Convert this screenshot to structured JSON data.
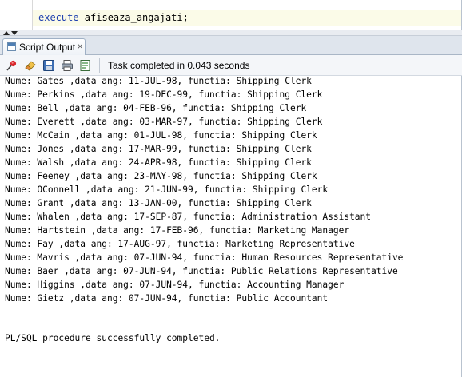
{
  "editor": {
    "code_keyword": "execute",
    "code_rest": " afiseaza_angajati;"
  },
  "output_panel": {
    "tab_label": "Script Output",
    "tab_close": "×",
    "status_text": "Task completed in 0.043 seconds",
    "toolbar_icons": [
      "pin-icon",
      "eraser-icon",
      "save-icon",
      "print-icon",
      "log-icon"
    ]
  },
  "output": {
    "lines": [
      "Nume: Gates ,data ang: 11-JUL-98, functia: Shipping Clerk",
      "Nume: Perkins ,data ang: 19-DEC-99, functia: Shipping Clerk",
      "Nume: Bell ,data ang: 04-FEB-96, functia: Shipping Clerk",
      "Nume: Everett ,data ang: 03-MAR-97, functia: Shipping Clerk",
      "Nume: McCain ,data ang: 01-JUL-98, functia: Shipping Clerk",
      "Nume: Jones ,data ang: 17-MAR-99, functia: Shipping Clerk",
      "Nume: Walsh ,data ang: 24-APR-98, functia: Shipping Clerk",
      "Nume: Feeney ,data ang: 23-MAY-98, functia: Shipping Clerk",
      "Nume: OConnell ,data ang: 21-JUN-99, functia: Shipping Clerk",
      "Nume: Grant ,data ang: 13-JAN-00, functia: Shipping Clerk",
      "Nume: Whalen ,data ang: 17-SEP-87, functia: Administration Assistant",
      "Nume: Hartstein ,data ang: 17-FEB-96, functia: Marketing Manager",
      "Nume: Fay ,data ang: 17-AUG-97, functia: Marketing Representative",
      "Nume: Mavris ,data ang: 07-JUN-94, functia: Human Resources Representative",
      "Nume: Baer ,data ang: 07-JUN-94, functia: Public Relations Representative",
      "Nume: Higgins ,data ang: 07-JUN-94, functia: Accounting Manager",
      "Nume: Gietz ,data ang: 07-JUN-94, functia: Public Accountant"
    ],
    "final_message": "PL/SQL procedure successfully completed."
  },
  "colors": {
    "keyword": "#1d3fae",
    "tab_bar": "#dfe5ed",
    "current_line": "#fbfbe8"
  }
}
